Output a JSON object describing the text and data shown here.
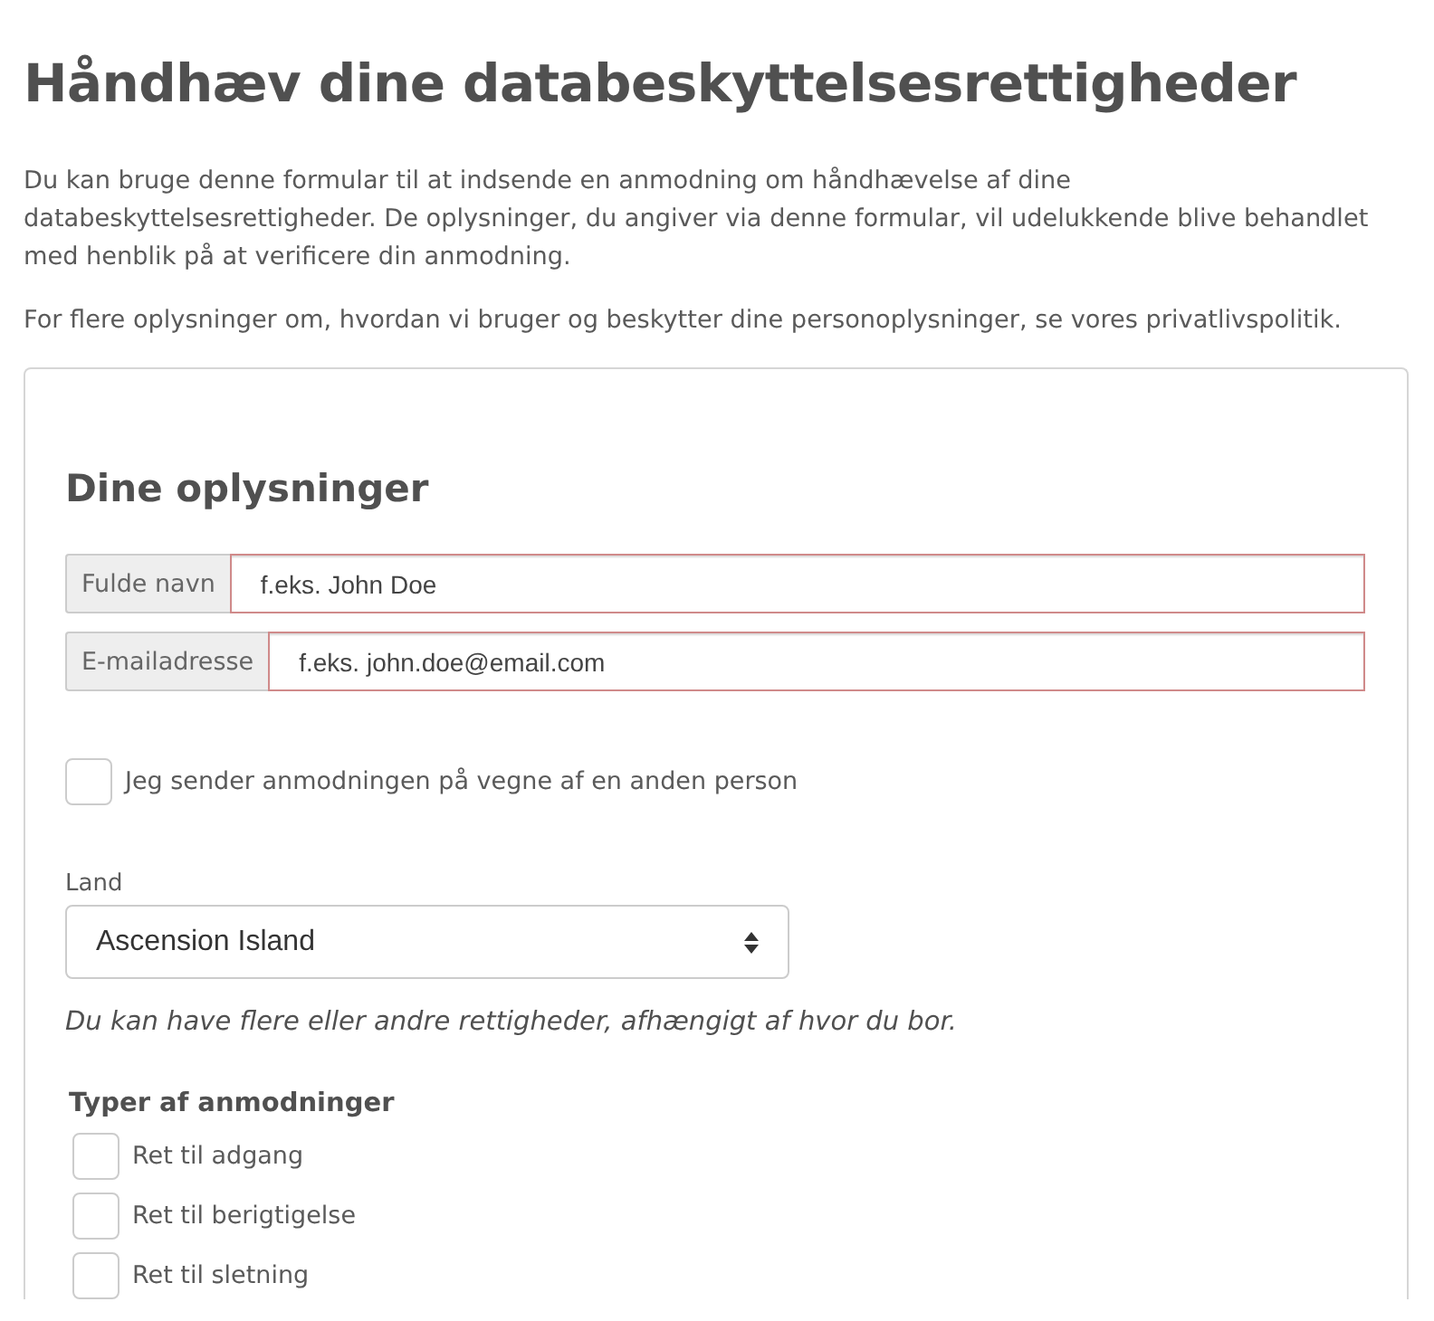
{
  "title": "Håndhæv dine databeskyttelsesrettigheder",
  "intro": [
    "Du kan bruge denne formular til at indsende en anmodning om håndhævelse af dine databeskyttelsesrettigheder. De oplysninger, du angiver via denne formular, vil udelukkende blive behandlet med henblik på at verificere din anmodning.",
    "For flere oplysninger om, hvordan vi bruger og beskytter dine personoplysninger, se vores privatlivspolitik."
  ],
  "section_title": "Dine oplysninger",
  "fields": [
    {
      "label": "Fulde navn",
      "placeholder": "f.eks. John Doe",
      "invalid": true
    },
    {
      "label": "E-mailadresse",
      "placeholder": "f.eks. john.doe@email.com",
      "invalid": true
    }
  ],
  "on_behalf": {
    "label": "Jeg sender anmodningen på vegne af en anden person",
    "checked": false
  },
  "country": {
    "label": "Land",
    "value": "Ascension Island"
  },
  "country_note": "Du kan have flere eller andre rettigheder, afhængigt af hvor du bor.",
  "request_types": {
    "title": "Typer af anmodninger",
    "items": [
      {
        "label": "Ret til adgang",
        "checked": false
      },
      {
        "label": "Ret til berigtigelse",
        "checked": false
      },
      {
        "label": "Ret til sletning",
        "checked": false
      }
    ]
  }
}
